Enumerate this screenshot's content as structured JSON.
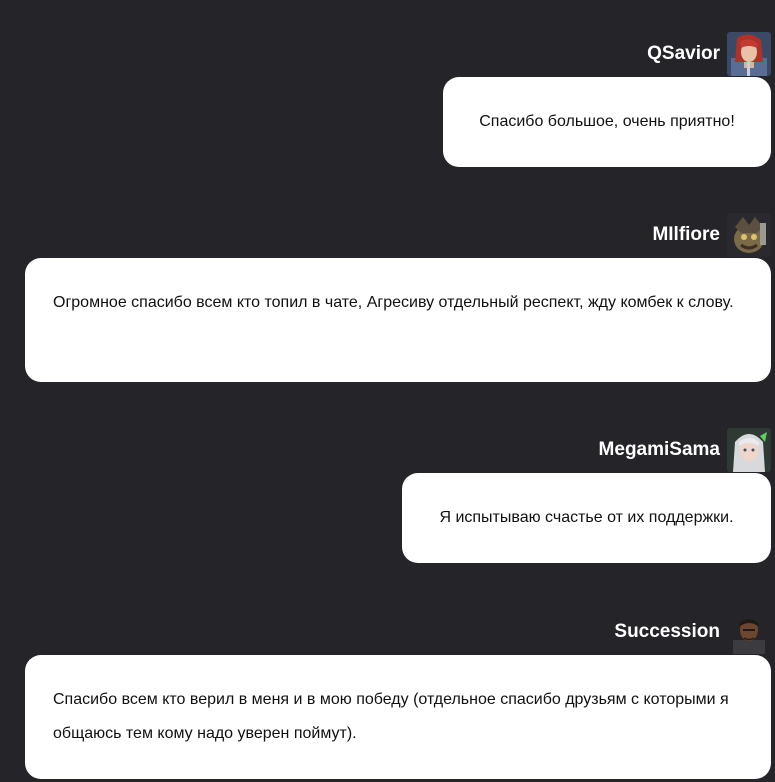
{
  "messages": [
    {
      "author": "QSavior",
      "avatar_icon": "avatar-red-haired-warrior-icon",
      "text": "Спасибо большое, очень приятно!"
    },
    {
      "author": "MIlfiore",
      "avatar_icon": "avatar-armored-creature-icon",
      "text": "Огромное спасибо всем кто топил в чате, Агресиву отдельный респект, жду комбек к слову."
    },
    {
      "author": "MegamiSama",
      "avatar_icon": "avatar-silver-haired-girl-icon",
      "text": "Я испытываю счастье от их поддержки."
    },
    {
      "author": "Succession",
      "avatar_icon": "avatar-dark-haired-man-icon",
      "text": "Спасибо всем кто верил в меня и в мою победу (отдельное спасибо друзьям с которыми я общаюсь тем кому надо уверен поймут)."
    }
  ],
  "colors": {
    "background": "#242429",
    "bubble": "#ffffff",
    "author_text": "#ffffff",
    "message_text": "#111111"
  }
}
